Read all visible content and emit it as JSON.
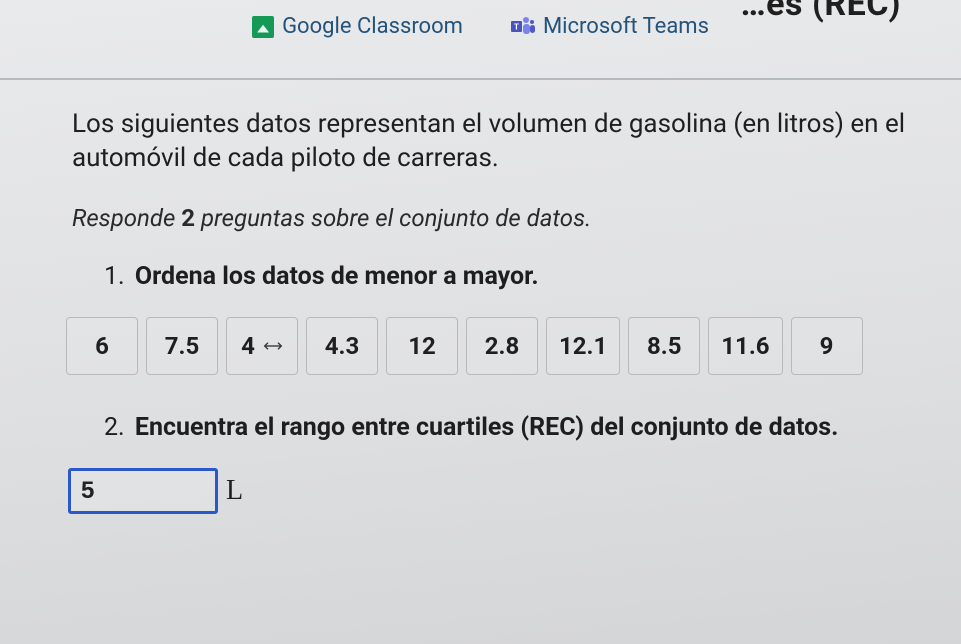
{
  "partial_heading": "…es (REC)",
  "share": {
    "google_classroom": "Google Classroom",
    "microsoft_teams": "Microsoft Teams"
  },
  "intro": "Los siguientes datos representan el volumen de gasolina (en litros) en el automóvil de cada piloto de carreras.",
  "instruction": {
    "prefix": "Responde ",
    "count": "2",
    "suffix": " preguntas sobre el conjunto de datos."
  },
  "questions": {
    "q1": {
      "number": "1.",
      "text": "Ordena los datos de menor a mayor.",
      "tiles": [
        "6",
        "7.5",
        "4",
        "4.3",
        "12",
        "2.8",
        "12.1",
        "8.5",
        "11.6",
        "9"
      ],
      "drag_tile_index": 2
    },
    "q2": {
      "number": "2.",
      "text": "Encuentra el rango entre cuartiles (REC) del conjunto de datos.",
      "answer_value": "5",
      "unit": "L"
    }
  }
}
